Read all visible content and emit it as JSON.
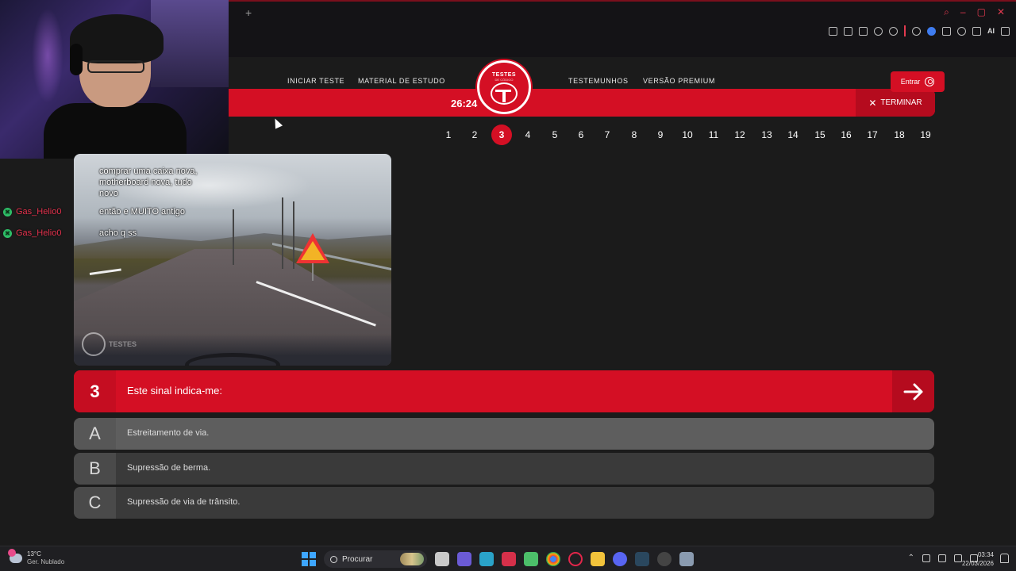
{
  "browser": {
    "new_tab_label": "+",
    "ai_label": "AI"
  },
  "site": {
    "nav_left": [
      "INICIAR TESTE",
      "MATERIAL DE ESTUDO"
    ],
    "nav_right": [
      "TESTEMUNHOS",
      "VERSÃO PREMIUM"
    ],
    "logo_text": "TESTES",
    "logo_subtext": "DE CÓDIGO",
    "enter_label": "Entrar"
  },
  "exam": {
    "timer": "26:24",
    "finish_label": "TERMINAR",
    "question_numbers": [
      "1",
      "2",
      "3",
      "4",
      "5",
      "6",
      "7",
      "8",
      "9",
      "10",
      "11",
      "12",
      "13",
      "14",
      "15",
      "16",
      "17",
      "18",
      "19"
    ],
    "active_question": 3,
    "question": {
      "number": "3",
      "text": "Este sinal indica-me:"
    },
    "answers": [
      {
        "letter": "A",
        "text": "Estreitamento de via.",
        "selected": true
      },
      {
        "letter": "B",
        "text": "Supressão de berma.",
        "selected": false
      },
      {
        "letter": "C",
        "text": "Supressão de via de trânsito.",
        "selected": false
      }
    ],
    "image_watermark": "TESTES"
  },
  "chat": {
    "messages": [
      "comprar uma caixa nova,",
      "motherboard nova, tudo",
      "novo",
      "então e MUITO antigo",
      "acho q ss"
    ],
    "users": [
      "Gas_Helio0",
      "Gas_Helio0"
    ]
  },
  "taskbar": {
    "weather_temp": "13°C",
    "weather_desc": "Ger. Nublado",
    "search_placeholder": "Procurar",
    "time": "03:34",
    "date": "22/03/2026"
  },
  "colors": {
    "brand_red": "#d40f24",
    "background": "#1b1b1b",
    "answer_bg": "#3a3a3a",
    "answer_selected_bg": "#5e5e5e"
  }
}
